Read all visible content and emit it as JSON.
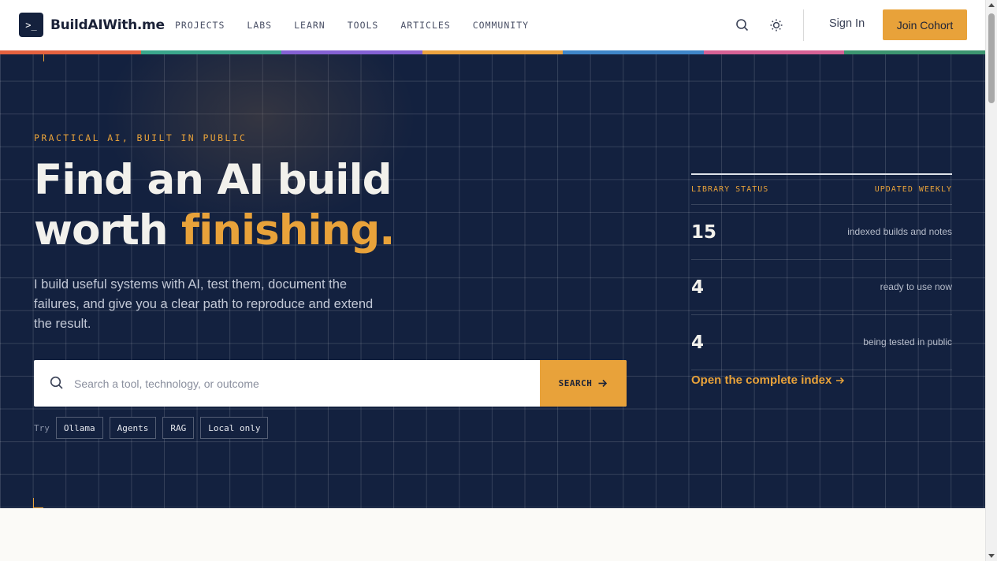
{
  "header": {
    "logo_mark": ">_",
    "logo_text": "BuildAIWith.me",
    "nav": [
      "PROJECTS",
      "LABS",
      "LEARN",
      "TOOLS",
      "ARTICLES",
      "COMMUNITY"
    ],
    "sign_in": "Sign In",
    "join": "Join Cohort"
  },
  "colors": {
    "rainbow": [
      "#e4613f",
      "#3aa68b",
      "#8461d4",
      "#eba23f",
      "#3f86c9",
      "#d66195",
      "#3c9570"
    ],
    "accent": "#e8a23a",
    "hero_bg": "#13213f"
  },
  "hero": {
    "eyebrow": "PRACTICAL AI, BUILT IN PUBLIC",
    "headline_line1": "Find an AI build",
    "headline_line2_plain": "worth ",
    "headline_line2_accent": "finishing.",
    "intro": "I build useful systems with AI, test them, document the failures, and give you a clear path to reproduce and extend the result.",
    "search": {
      "placeholder": "Search a tool, technology, or outcome",
      "button": "SEARCH"
    },
    "try_label": "Try",
    "suggestions": [
      "Ollama",
      "Agents",
      "RAG",
      "Local only"
    ]
  },
  "status": {
    "title": "LIBRARY STATUS",
    "cadence": "UPDATED WEEKLY",
    "stats": [
      {
        "value": "15",
        "label": "indexed builds and notes"
      },
      {
        "value": "4",
        "label": "ready to use now"
      },
      {
        "value": "4",
        "label": "being tested in public"
      }
    ],
    "link": "Open the complete index"
  }
}
